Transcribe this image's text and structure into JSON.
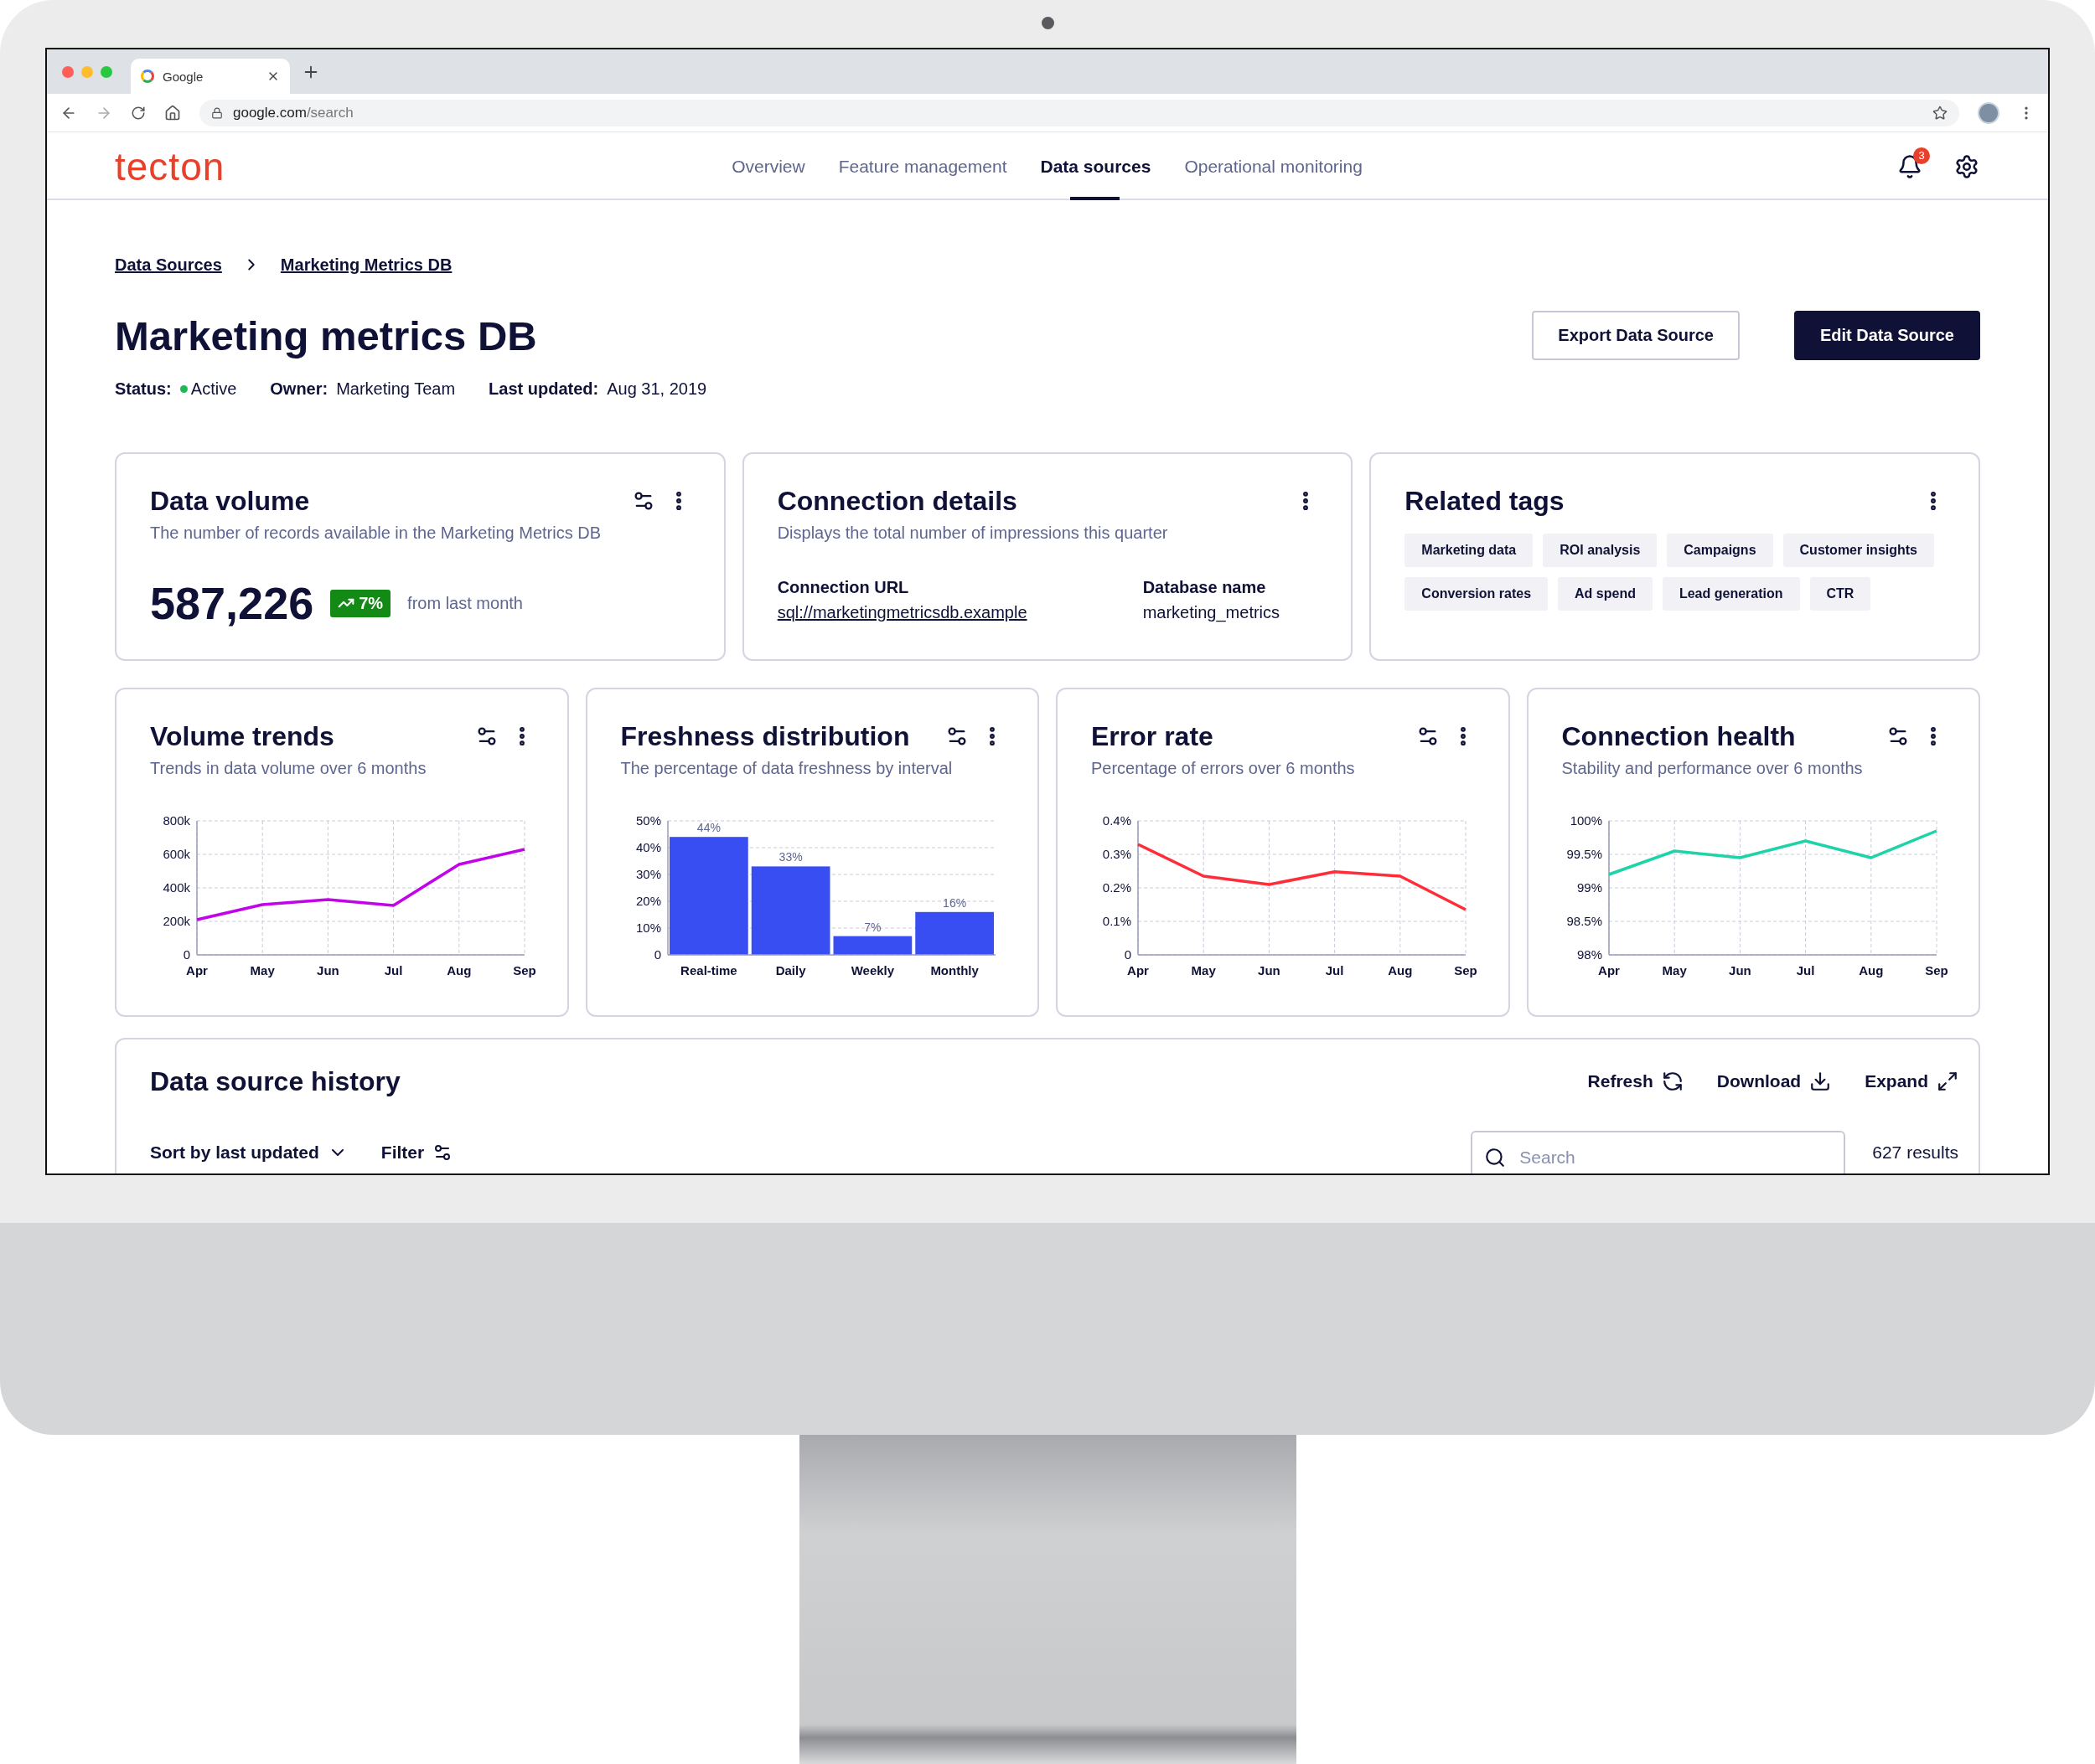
{
  "browser": {
    "tab_title": "Google",
    "url_domain": "google.com",
    "url_path": "/search"
  },
  "app": {
    "logo": "tecton",
    "nav": [
      {
        "label": "Overview",
        "selected": false
      },
      {
        "label": "Feature management",
        "selected": false
      },
      {
        "label": "Data sources",
        "selected": true
      },
      {
        "label": "Operational monitoring",
        "selected": false
      }
    ],
    "notifications": "3"
  },
  "breadcrumb": [
    "Data Sources",
    "Marketing Metrics DB"
  ],
  "page": {
    "title": "Marketing metrics DB",
    "buttons": [
      {
        "label": "Export Data Source",
        "kind": "secondary"
      },
      {
        "label": "Edit Data Source",
        "kind": "primary"
      }
    ],
    "meta": [
      {
        "label": "Status:",
        "value": "Active",
        "kind": "status",
        "active": true
      },
      {
        "label": "Owner:",
        "value": "Marketing Team",
        "kind": "text"
      },
      {
        "label": "Last updated:",
        "value": "Aug 31, 2019",
        "kind": "text"
      }
    ]
  },
  "data_volume": {
    "title": "Data volume",
    "subtitle": "The number of records available in the Marketing Metrics DB",
    "value": "587,226",
    "change": "7%",
    "change_note": "from last month"
  },
  "connection": {
    "title": "Connection details",
    "subtitle": "Displays the total number of impressions this quarter",
    "fields": [
      {
        "label": "Connection URL",
        "value": "sql://marketingmetricsdb.example",
        "kind": "link"
      },
      {
        "label": "Database name",
        "value": "marketing_metrics",
        "kind": "text"
      }
    ]
  },
  "tags": {
    "title": "Related tags",
    "items": [
      "Marketing data",
      "ROI analysis",
      "Campaigns",
      "Customer insights",
      "Conversion rates",
      "Ad spend",
      "Lead generation",
      "CTR"
    ]
  },
  "charts": [
    {
      "title": "Volume trends",
      "subtitle": "Trends in data volume over 6 months",
      "chart_data": {
        "type": "line",
        "grid": true,
        "categories": [
          "Apr",
          "May",
          "Jun",
          "Jul",
          "Aug",
          "Sep"
        ],
        "ylim": [
          0,
          800000
        ],
        "yticks": [
          {
            "value": 0,
            "label": "0"
          },
          {
            "value": 200000,
            "label": "200k"
          },
          {
            "value": 400000,
            "label": "400k"
          },
          {
            "value": 600000,
            "label": "600k"
          },
          {
            "value": 800000,
            "label": "800k"
          }
        ],
        "series": [
          {
            "color": "#c104e8",
            "values": [
              210000,
              300000,
              330000,
              295000,
              540000,
              630000
            ]
          }
        ]
      }
    },
    {
      "title": "Freshness distribution",
      "subtitle": "The percentage of data freshness by interval",
      "chart_data": {
        "type": "bar",
        "grid": true,
        "categories": [
          "Real-time",
          "Daily",
          "Weekly",
          "Monthly"
        ],
        "ylim": [
          0,
          50
        ],
        "yticks": [
          {
            "value": 0,
            "label": "0"
          },
          {
            "value": 10,
            "label": "10%"
          },
          {
            "value": 20,
            "label": "20%"
          },
          {
            "value": 30,
            "label": "30%"
          },
          {
            "value": 40,
            "label": "40%"
          },
          {
            "value": 50,
            "label": "50%"
          }
        ],
        "series": [
          {
            "color": "#384ef2",
            "values": [
              44,
              33,
              7,
              16
            ]
          }
        ],
        "value_labels": [
          "44%",
          "33%",
          "7%",
          "16%"
        ]
      }
    },
    {
      "title": "Error rate",
      "subtitle": "Percentage of errors over 6 months",
      "chart_data": {
        "type": "line",
        "grid": true,
        "categories": [
          "Apr",
          "May",
          "Jun",
          "Jul",
          "Aug",
          "Sep"
        ],
        "ylim": [
          0,
          0.4
        ],
        "yticks": [
          {
            "value": 0,
            "label": "0"
          },
          {
            "value": 0.1,
            "label": "0.1%"
          },
          {
            "value": 0.2,
            "label": "0.2%"
          },
          {
            "value": 0.3,
            "label": "0.3%"
          },
          {
            "value": 0.4,
            "label": "0.4%"
          }
        ],
        "series": [
          {
            "color": "#ff2d3a",
            "values": [
              0.33,
              0.235,
              0.21,
              0.248,
              0.235,
              0.135
            ]
          }
        ]
      }
    },
    {
      "title": "Connection health",
      "subtitle": "Stability and performance over 6 months",
      "chart_data": {
        "type": "line",
        "grid": true,
        "categories": [
          "Apr",
          "May",
          "Jun",
          "Jul",
          "Aug",
          "Sep"
        ],
        "ylim": [
          98,
          100
        ],
        "yticks": [
          {
            "value": 98,
            "label": "98%"
          },
          {
            "value": 98.5,
            "label": "98.5%"
          },
          {
            "value": 99,
            "label": "99%"
          },
          {
            "value": 99.5,
            "label": "99.5%"
          },
          {
            "value": 100,
            "label": "100%"
          }
        ],
        "series": [
          {
            "color": "#1dd3a7",
            "values": [
              99.2,
              99.55,
              99.45,
              99.7,
              99.45,
              99.85
            ]
          }
        ]
      }
    }
  ],
  "history": {
    "title": "Data source history",
    "actions": [
      {
        "label": "Refresh",
        "kind": "refresh"
      },
      {
        "label": "Download",
        "kind": "download"
      },
      {
        "label": "Expand",
        "kind": "expand"
      }
    ],
    "sort": "Sort by last updated",
    "filter": "Filter",
    "search": {
      "placeholder": "Search"
    },
    "results": "627 results"
  }
}
